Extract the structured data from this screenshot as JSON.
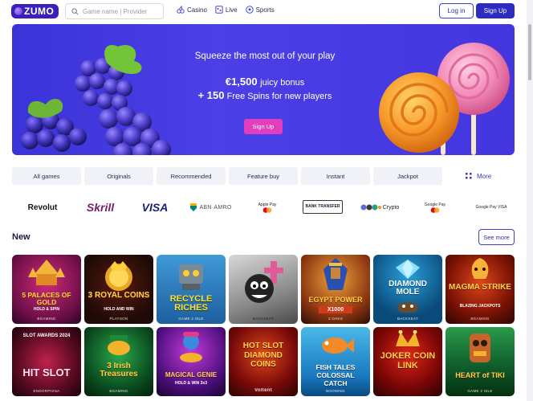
{
  "header": {
    "logo_text": "ZUMO",
    "search_placeholder": "Game name | Provider",
    "nav": [
      {
        "label": "Casino",
        "icon": "cherries-icon"
      },
      {
        "label": "Live",
        "icon": "live-icon"
      },
      {
        "label": "Sports",
        "icon": "soccer-ball-icon"
      }
    ],
    "login_label": "Log in",
    "signup_label": "Sign Up"
  },
  "hero": {
    "tagline": "Squeeze the most out of your play",
    "bonus_amount": "€1,500",
    "bonus_text": "juicy bonus",
    "spins_amount": "+ 150",
    "spins_text": "Free Spins for new players",
    "cta_label": "Sign Up"
  },
  "tabs": [
    "All games",
    "Originals",
    "Recommended",
    "Feature buy",
    "Instant",
    "Jackpot"
  ],
  "more_label": "More",
  "payments": [
    "Revolut",
    "Skrill",
    "VISA",
    "ABN·AMRO",
    "Apple Pay",
    "BANK TRANSFER",
    "Crypto",
    "Google Pay",
    "Google Pay VISA"
  ],
  "new_section": {
    "title": "New",
    "see_more_label": "See more"
  },
  "games_row1": [
    {
      "title": "5 PALACES OF GOLD",
      "sub": "HOLD & SPIN",
      "provider": "BGAMING"
    },
    {
      "title": "3 ROYAL COINS",
      "sub": "HOLD AND WIN",
      "provider": "PLAYSON"
    },
    {
      "title": "RECYCLE RICHES",
      "sub": "",
      "provider": "GAME 2 ISLE"
    },
    {
      "title": "",
      "sub": "",
      "provider": "BACKSEAT"
    },
    {
      "title": "EGYPT POWER",
      "sub": "X1000",
      "provider": "3 OAKS"
    },
    {
      "title": "DIAMOND MOLE",
      "sub": "",
      "provider": "BACKSEAT"
    },
    {
      "title": "MAGMA STRIKE",
      "sub": "BLAZING JACKPOTS",
      "provider": "BGAMING"
    }
  ],
  "games_row2": [
    {
      "title": "HIT SLOT",
      "sub": "SLOT AWARDS 2024",
      "provider": "ENDORPHINA"
    },
    {
      "title": "3 Irish Treasures",
      "sub": "",
      "provider": "BGAMING"
    },
    {
      "title": "MAGICAL GENIE",
      "sub": "HOLD & WIN 3x3",
      "provider": ""
    },
    {
      "title": "HOT SLOT DIAMOND COINS",
      "sub": "",
      "provider": "Voltent"
    },
    {
      "title": "FISH TALES COLOSSAL CATCH",
      "sub": "",
      "provider": "BOOMING"
    },
    {
      "title": "JOKER COIN LINK",
      "sub": "",
      "provider": ""
    },
    {
      "title": "HEART of TIKI",
      "sub": "",
      "provider": "GAME 2 ISLE"
    }
  ],
  "colors": {
    "brand": "#2c2cc0",
    "hero_bg": "#4336df",
    "cta": "#e23fbe"
  }
}
